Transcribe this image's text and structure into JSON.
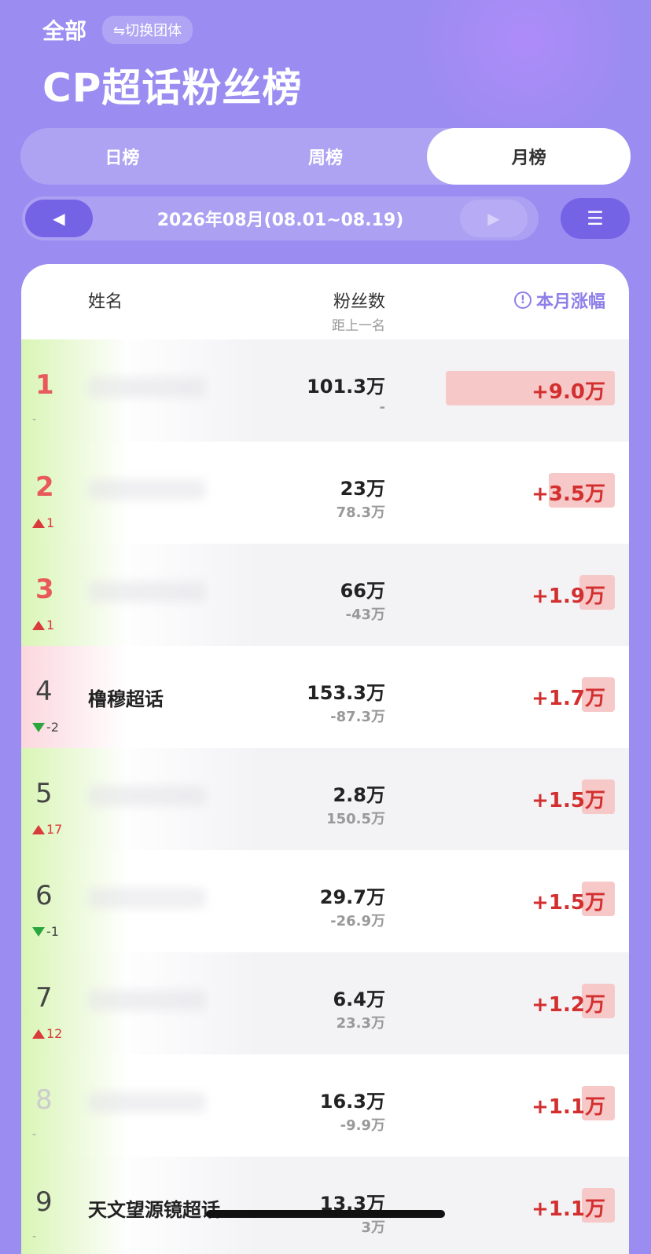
{
  "header": {
    "scope_label": "全部",
    "switch_group_label": "⇋切换团体",
    "title": "CP超话粉丝榜"
  },
  "tabs": [
    {
      "label": "日榜",
      "active": false
    },
    {
      "label": "周榜",
      "active": false
    },
    {
      "label": "月榜",
      "active": true
    }
  ],
  "date_nav": {
    "prev_icon": "◀",
    "label": "2026年08月(08.01~08.19)",
    "next_icon": "▶",
    "sort_icon": "☰"
  },
  "table": {
    "col_name": "姓名",
    "col_fans": "粉丝数",
    "col_gap": "距上一名",
    "col_growth": "本月涨幅",
    "info_icon": "!",
    "rows": [
      {
        "rank": "1",
        "change_dir": "none",
        "change": "-",
        "name": "",
        "fans": "101.3万",
        "gap": "-",
        "growth": "+9.0万",
        "growth_fraction": 1.0
      },
      {
        "rank": "2",
        "change_dir": "up",
        "change": "1",
        "name": "",
        "fans": "23万",
        "gap": "78.3万",
        "growth": "+3.5万",
        "growth_fraction": 0.39
      },
      {
        "rank": "3",
        "change_dir": "up",
        "change": "1",
        "name": "",
        "fans": "66万",
        "gap": "-43万",
        "growth": "+1.9万",
        "growth_fraction": 0.21
      },
      {
        "rank": "4",
        "change_dir": "down",
        "change": "-2",
        "name": "橹穆超话",
        "fans": "153.3万",
        "gap": "-87.3万",
        "growth": "+1.7万",
        "growth_fraction": 0.19
      },
      {
        "rank": "5",
        "change_dir": "up",
        "change": "17",
        "name": "",
        "fans": "2.8万",
        "gap": "150.5万",
        "growth": "+1.5万",
        "growth_fraction": 0.17
      },
      {
        "rank": "6",
        "change_dir": "down",
        "change": "-1",
        "name": "",
        "fans": "29.7万",
        "gap": "-26.9万",
        "growth": "+1.5万",
        "growth_fraction": 0.17
      },
      {
        "rank": "7",
        "change_dir": "up",
        "change": "12",
        "name": "",
        "fans": "6.4万",
        "gap": "23.3万",
        "growth": "+1.2万",
        "growth_fraction": 0.13
      },
      {
        "rank": "8",
        "change_dir": "none",
        "change": "-",
        "name": "",
        "fans": "16.3万",
        "gap": "-9.9万",
        "growth": "+1.1万",
        "growth_fraction": 0.12
      },
      {
        "rank": "9",
        "change_dir": "none",
        "change": "-",
        "name": "天文望源镜超话",
        "fans": "13.3万",
        "gap": "3万",
        "growth": "+1.1万",
        "growth_fraction": 0.12
      }
    ]
  }
}
